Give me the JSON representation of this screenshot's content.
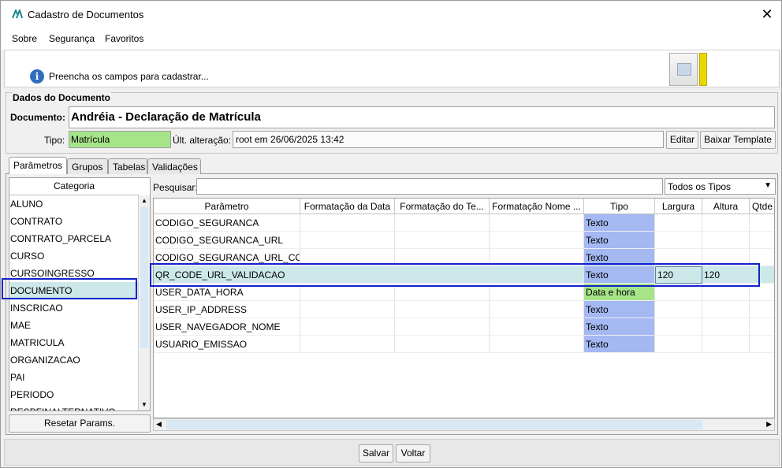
{
  "window": {
    "title": "Cadastro de Documentos"
  },
  "menu": [
    {
      "label": "Sobre"
    },
    {
      "label": "Segurança"
    },
    {
      "label": "Favoritos"
    }
  ],
  "info": {
    "message": "Preencha os campos para cadastrar..."
  },
  "dados": {
    "legend": "Dados do Documento",
    "documento_label": "Documento:",
    "documento_value": "Andréia - Declaração de Matrícula",
    "tipo_label": "Tipo:",
    "tipo_value": "Matrícula",
    "ult_label": "Últ. alteração:",
    "ult_value": "root em 26/06/2025 13:42",
    "editar_label": "Editar",
    "baixar_label": "Baixar Template"
  },
  "tabs": [
    {
      "label": "Parâmetros"
    },
    {
      "label": "Grupos"
    },
    {
      "label": "Tabelas"
    },
    {
      "label": "Validações"
    }
  ],
  "categoria": {
    "header": "Categoria",
    "items": [
      "ALUNO",
      "CONTRATO",
      "CONTRATO_PARCELA",
      "CURSO",
      "CURSOINGRESSO",
      "DOCUMENTO",
      "INSCRICAO",
      "MAE",
      "MATRICULA",
      "ORGANIZACAO",
      "PAI",
      "PERIODO",
      "RESPFINALTERNATIVO"
    ],
    "selected": "DOCUMENTO",
    "reset_label": "Resetar Params."
  },
  "search": {
    "label": "Pesquisar:",
    "value": "",
    "filter_value": "Todos os Tipos"
  },
  "grid": {
    "columns": [
      "Parâmetro",
      "Formatação da Data",
      "Formatação do Te...",
      "Formatação Nome ...",
      "Tipo",
      "Largura",
      "Altura",
      "Qtde"
    ],
    "rows": [
      {
        "parametro": "CODIGO_SEGURANCA",
        "tipo": "Texto",
        "largura": "",
        "altura": ""
      },
      {
        "parametro": "CODIGO_SEGURANCA_URL",
        "tipo": "Texto",
        "largura": "",
        "altura": ""
      },
      {
        "parametro": "CODIGO_SEGURANCA_URL_CO...",
        "tipo": "Texto",
        "largura": "",
        "altura": ""
      },
      {
        "parametro": "QR_CODE_URL_VALIDACAO",
        "tipo": "Texto",
        "largura": "120",
        "altura": "120"
      },
      {
        "parametro": "USER_DATA_HORA",
        "tipo": "Data e hora",
        "largura": "",
        "altura": ""
      },
      {
        "parametro": "USER_IP_ADDRESS",
        "tipo": "Texto",
        "largura": "",
        "altura": ""
      },
      {
        "parametro": "USER_NAVEGADOR_NOME",
        "tipo": "Texto",
        "largura": "",
        "altura": ""
      },
      {
        "parametro": "USUARIO_EMISSAO",
        "tipo": "Texto",
        "largura": "",
        "altura": ""
      }
    ]
  },
  "footer": {
    "salvar_label": "Salvar",
    "voltar_label": "Voltar"
  },
  "colors": {
    "tipo_texto": "#a4b8f2",
    "tipo_data": "#a6e48a",
    "selected_row": "#cde8e8",
    "highlight_box": "#1122cc"
  }
}
